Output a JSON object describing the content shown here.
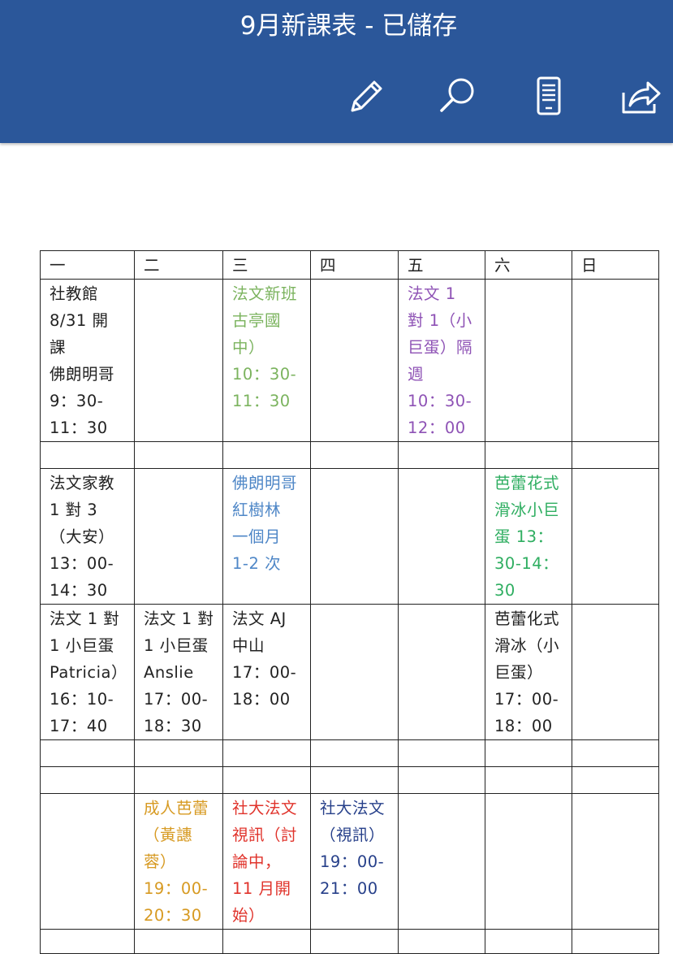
{
  "header": {
    "title": "9月新課表 - 已儲存"
  },
  "toolbar": {
    "edit_icon": "pencil-icon",
    "search_icon": "search-icon",
    "reading_icon": "reading-view-icon",
    "share_icon": "share-icon"
  },
  "colors": {
    "header_bg": "#2b579a",
    "green": "#7bb35e",
    "purple": "#8e52b5",
    "blue": "#4f87c7",
    "teal": "#2fae61",
    "orange": "#d79a22",
    "red": "#e0332b",
    "navy": "#27408a"
  },
  "table": {
    "days": [
      "一",
      "二",
      "三",
      "四",
      "五",
      "六",
      "日"
    ],
    "r1": {
      "mon": [
        "社教館",
        "8/31 開",
        "課",
        "佛朗明哥",
        "9：30-",
        "11：30"
      ],
      "wed": [
        "法文新班",
        "古亭國",
        "中）",
        "10：30-",
        "11：30"
      ],
      "fri": [
        "法文 1",
        "對 1（小",
        "巨蛋）隔",
        "週",
        "10：30-",
        "12：00"
      ]
    },
    "r3": {
      "mon": [
        "法文家教",
        "1 對 3",
        "（大安）",
        "13：00-",
        "14：30"
      ],
      "wed": [
        "佛朗明哥",
        "紅樹林",
        "一個月",
        "1-2 次"
      ],
      "sat": [
        "芭蕾花式",
        "滑冰小巨",
        "蛋 13：",
        "30-14：",
        "30"
      ]
    },
    "r4": {
      "mon": [
        "法文 1 對",
        "1 小巨蛋",
        "Patricia）",
        "16：10-",
        "17：40"
      ],
      "tue": [
        "法文 1 對",
        "1 小巨蛋",
        "Anslie",
        "17：00-",
        "18：30"
      ],
      "wed": [
        "法文 AJ",
        "中山",
        "17：00-",
        "18：00"
      ],
      "sat": [
        "芭蕾化式",
        "滑冰（小",
        "巨蛋）",
        "17：00-",
        "18：00"
      ]
    },
    "r7": {
      "tue": [
        "成人芭蕾",
        "（黃譓",
        "蓉）",
        "19：00-",
        "20：30"
      ],
      "wed": [
        "社大法文",
        "視訊（討",
        "論中，",
        "11 月開",
        "始）"
      ],
      "thu": [
        "社大法文",
        "（視訊）",
        "19：00-",
        "21：00"
      ]
    }
  }
}
